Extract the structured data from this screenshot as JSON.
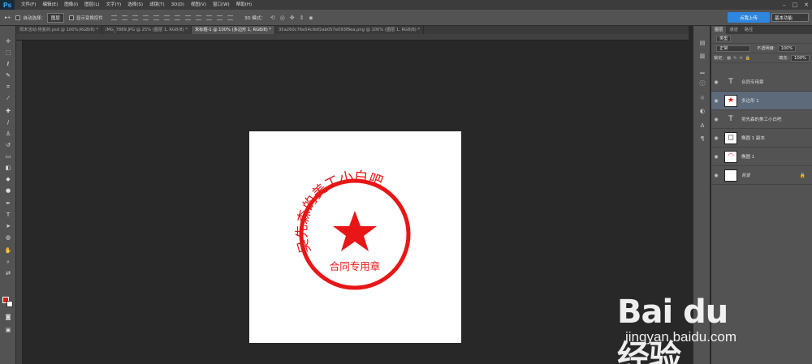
{
  "app": {
    "logo": "Ps"
  },
  "menu": [
    "文件(F)",
    "编辑(E)",
    "图像(I)",
    "图层(L)",
    "文字(Y)",
    "选择(S)",
    "滤镜(T)",
    "3D(D)",
    "视图(V)",
    "窗口(W)",
    "帮助(H)"
  ],
  "window_controls": [
    "–",
    "□",
    "✕"
  ],
  "options": {
    "tool_icon": "▸+",
    "auto_select_label": "自动选择：",
    "auto_select_value": "图层",
    "show_transform_label": "显示变换控件",
    "mode_3d_label": "3D 模式："
  },
  "upload_button": "点我上传",
  "workspace": "基本功能",
  "tabs": [
    "周末活动-恢复的.psd @ 100%(RGB/8) *",
    "IMG_7889.JPG @ 25% (图层 1, RGB/8) *",
    "未标题-1 @ 100% (多边形 1, RGB/8) *",
    "35a260c76e54c9df2ab057e093f8ea.png @ 100% (图层 1, RGB/8) *"
  ],
  "active_tab_index": 2,
  "stamp": {
    "arc_text": "吴先森的美工小白吧",
    "bottom_text": "合同专用章",
    "color": "#e81616"
  },
  "panel": {
    "tabs": [
      "图层",
      "通道",
      "路径"
    ],
    "kind_filter": "类型",
    "blend_mode": "正常",
    "opacity_label": "不透明度:",
    "opacity_value": "100%",
    "lock_label": "锁定:",
    "fill_label": "填充:",
    "fill_value": "100%"
  },
  "layers": [
    {
      "name": "合同专用章",
      "type": "text",
      "selected": false
    },
    {
      "name": "多边形 1",
      "type": "shape",
      "selected": true
    },
    {
      "name": "吴先森的美工小白吧",
      "type": "text",
      "selected": false
    },
    {
      "name": "椭圆 1 副本",
      "type": "shape",
      "selected": false
    },
    {
      "name": "椭圆 1",
      "type": "shape",
      "selected": false
    },
    {
      "name": "背景",
      "type": "background",
      "selected": false
    }
  ],
  "watermark": {
    "brand": "Bai du 经验",
    "url": "jingyan.baidu.com"
  }
}
